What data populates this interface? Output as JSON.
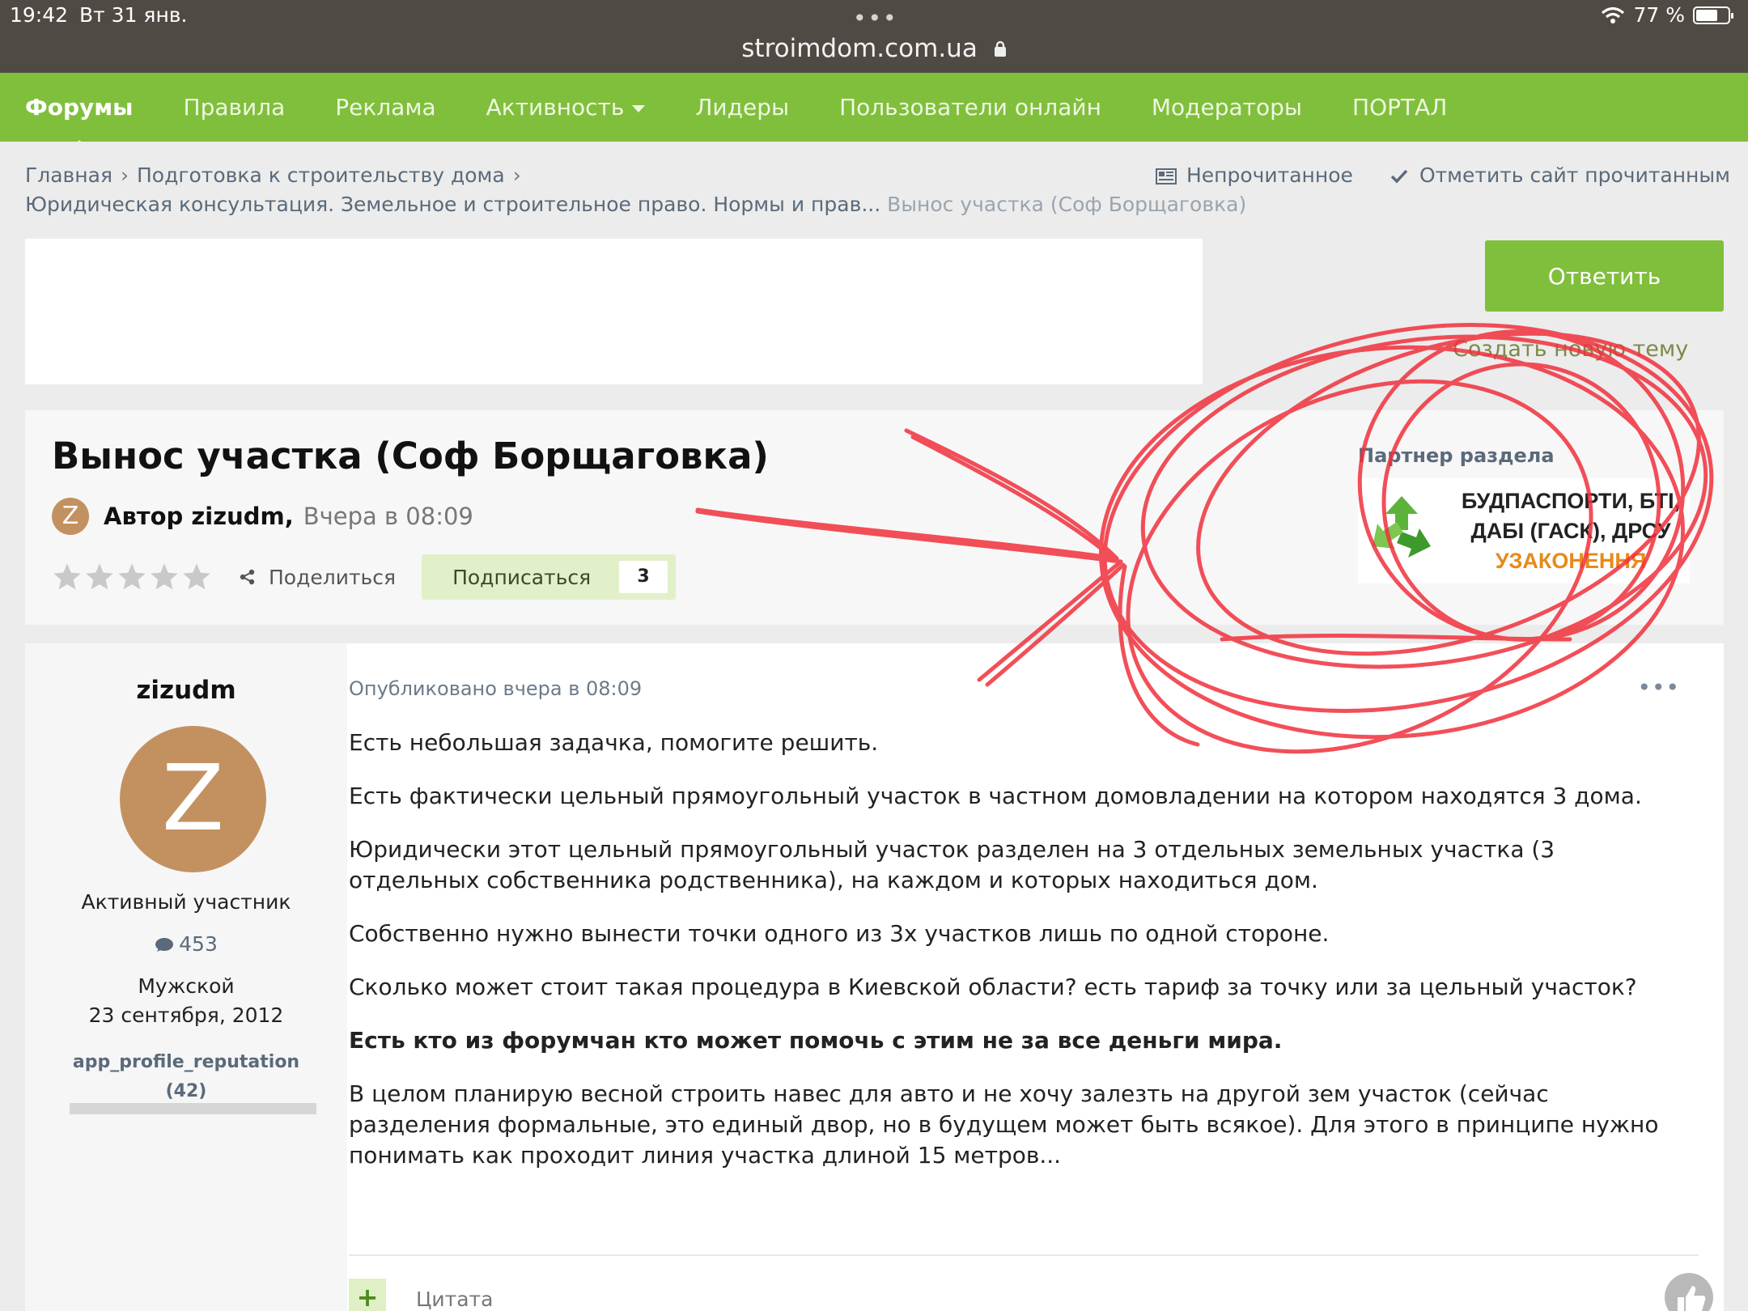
{
  "status_bar": {
    "time": "19:42",
    "date": "Вт 31 янв.",
    "dots": "•••",
    "url": "stroimdom.com.ua",
    "battery": "77 %"
  },
  "nav": {
    "items": [
      {
        "label": "Форумы"
      },
      {
        "label": "Правила"
      },
      {
        "label": "Реклама"
      },
      {
        "label": "Активность"
      },
      {
        "label": "Лидеры"
      },
      {
        "label": "Пользователи онлайн"
      },
      {
        "label": "Модераторы"
      },
      {
        "label": "ПОРТАЛ"
      }
    ]
  },
  "breadcrumb": {
    "home": "Главная",
    "level1": "Подготовка к строительству дома",
    "level2": "Юридическая консультация. Земельное и строительное право. Нормы и прав...",
    "current": "Вынос участка (Соф Борщаговка)"
  },
  "header_actions": {
    "unread": "Непрочитанное",
    "mark_read": "Отметить сайт прочитанным"
  },
  "reply_button": "Ответить",
  "new_topic": "Создать новую тему",
  "topic": {
    "title": "Вынос участка (Соф Борщаговка)",
    "avatar_letter": "Z",
    "author_prefix": "Автор zizudm,",
    "author_time": "Вчера в 08:09",
    "rating": 0,
    "rating_max": 5,
    "share": "Поделиться",
    "follow": "Подписаться",
    "follow_count": "3"
  },
  "partner": {
    "label": "Партнер раздела",
    "line1": "БУДПАСПОРТИ, БТІ,",
    "line2": "ДАБІ (ГАСК), ДРСУ",
    "line3": "УЗАКОНЕННЯ"
  },
  "post": {
    "username": "zizudm",
    "avatar_letter": "Z",
    "rank": "Активный участник",
    "post_count": "453",
    "gender": "Мужской",
    "joined": "23 сентября, 2012",
    "reputation_label": "app_profile_reputation",
    "reputation_value": "(42)",
    "meta": "Опубликовано вчера в 08:09",
    "more": "•••",
    "paragraphs": [
      "Есть небольшая задачка, помогите решить.",
      "Есть фактически цельный прямоугольный участок в частном домовладении на котором находятся 3 дома.",
      "Юридически этот цельный прямоугольный участок разделен на 3 отдельных земельных участка (3 отдельных собственника родственника), на каждом и которых находиться дом.",
      "Собственно нужно вынести точки одного из 3х участков лишь по одной стороне.",
      "Сколько может стоит такая процедура в Киевской области? есть тариф за точку или за цельный участок?",
      "Есть кто из форумчан кто может помочь с этим не за все деньги мира.",
      "В целом планирую весной строить навес для авто и не хочу залезть на другой зем участок (сейчас разделения формальные, это единый двор, но в будущем может быть всякое). Для этого в принципе нужно понимать как проходит линия участка длиной 15 метров..."
    ],
    "quote": "Цитата",
    "quote_plus": "+"
  },
  "colors": {
    "nav_green": "#80bf3b",
    "annotation_red": "#f0303c",
    "avatar": "#c39160"
  }
}
